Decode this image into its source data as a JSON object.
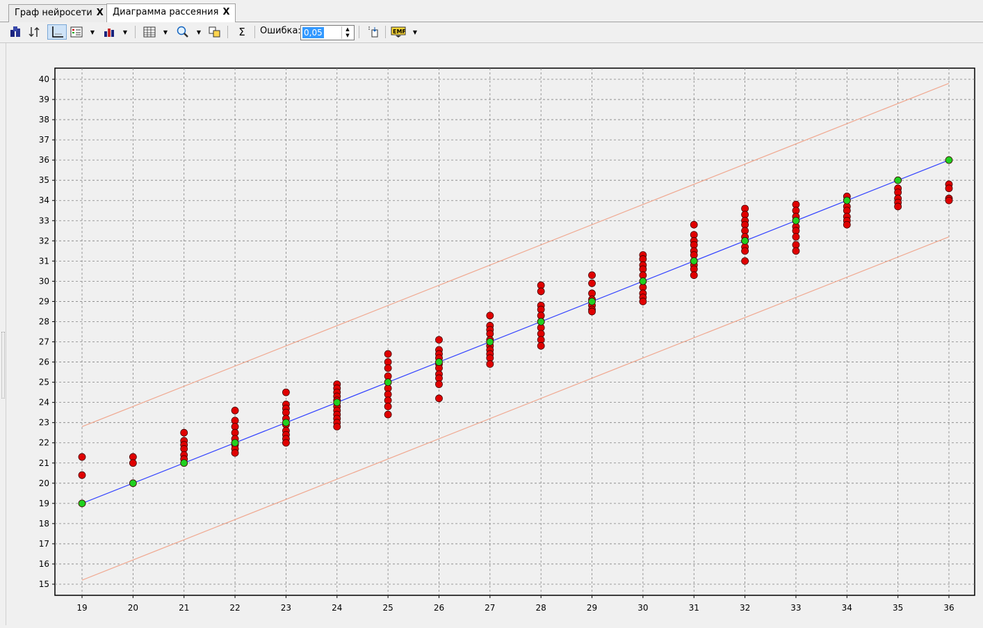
{
  "tabs": [
    {
      "label": "Граф нейросети",
      "close": "X"
    },
    {
      "label": "Диаграмма рассеяния",
      "close": "X"
    }
  ],
  "toolbar": {
    "error_label": "Ошибка:",
    "error_value": "0,05",
    "sigma": "Σ",
    "emf": "EMF"
  },
  "colors": {
    "plot_bg": "#f0f0f0",
    "ideal_line": "#3040ff",
    "tolerance_line": "#f0a890",
    "point_red": "#e00000",
    "point_green": "#20d020"
  },
  "chart_data": {
    "type": "scatter",
    "xlim": [
      19,
      36
    ],
    "ylim": [
      15,
      40
    ],
    "x_ticks": [
      19,
      20,
      21,
      22,
      23,
      24,
      25,
      26,
      27,
      28,
      29,
      30,
      31,
      32,
      33,
      34,
      35,
      36
    ],
    "y_ticks": [
      15,
      16,
      17,
      18,
      19,
      20,
      21,
      22,
      23,
      24,
      25,
      26,
      27,
      28,
      29,
      30,
      31,
      32,
      33,
      34,
      35,
      36,
      37,
      38,
      39,
      40
    ],
    "grid": true,
    "lines": [
      {
        "points": [
          [
            19,
            19
          ],
          [
            36,
            36
          ]
        ]
      },
      {
        "points": [
          [
            19,
            22.8
          ],
          [
            36,
            39.8
          ]
        ]
      },
      {
        "points": [
          [
            19,
            15.2
          ],
          [
            36,
            32.2
          ]
        ]
      }
    ],
    "series": [
      {
        "points": [
          [
            19,
            21.3
          ],
          [
            19,
            20.4
          ],
          [
            20,
            21.3
          ],
          [
            20,
            21.0
          ],
          [
            21,
            22.5
          ],
          [
            21,
            22.1
          ],
          [
            21,
            21.9
          ],
          [
            21,
            21.7
          ],
          [
            21,
            21.4
          ],
          [
            21,
            21.2
          ],
          [
            22,
            23.6
          ],
          [
            22,
            23.1
          ],
          [
            22,
            22.8
          ],
          [
            22,
            22.5
          ],
          [
            22,
            22.2
          ],
          [
            22,
            21.9
          ],
          [
            22,
            21.7
          ],
          [
            22,
            21.5
          ],
          [
            23,
            24.5
          ],
          [
            23,
            23.9
          ],
          [
            23,
            23.7
          ],
          [
            23,
            23.5
          ],
          [
            23,
            23.2
          ],
          [
            23,
            22.9
          ],
          [
            23,
            22.6
          ],
          [
            23,
            22.4
          ],
          [
            23,
            22.2
          ],
          [
            23,
            22.0
          ],
          [
            24,
            24.9
          ],
          [
            24,
            24.7
          ],
          [
            24,
            24.5
          ],
          [
            24,
            24.3
          ],
          [
            24,
            24.1
          ],
          [
            24,
            23.8
          ],
          [
            24,
            23.6
          ],
          [
            24,
            23.4
          ],
          [
            24,
            23.2
          ],
          [
            24,
            23.0
          ],
          [
            24,
            22.8
          ],
          [
            25,
            26.4
          ],
          [
            25,
            26.0
          ],
          [
            25,
            25.7
          ],
          [
            25,
            25.3
          ],
          [
            25,
            25.0
          ],
          [
            25,
            24.7
          ],
          [
            25,
            24.4
          ],
          [
            25,
            24.1
          ],
          [
            25,
            23.8
          ],
          [
            25,
            23.4
          ],
          [
            26,
            27.1
          ],
          [
            26,
            26.6
          ],
          [
            26,
            26.4
          ],
          [
            26,
            26.2
          ],
          [
            26,
            25.9
          ],
          [
            26,
            25.7
          ],
          [
            26,
            25.4
          ],
          [
            26,
            25.2
          ],
          [
            26,
            24.9
          ],
          [
            26,
            24.2
          ],
          [
            27,
            28.3
          ],
          [
            27,
            27.8
          ],
          [
            27,
            27.6
          ],
          [
            27,
            27.4
          ],
          [
            27,
            27.1
          ],
          [
            27,
            26.8
          ],
          [
            27,
            26.6
          ],
          [
            27,
            26.4
          ],
          [
            27,
            26.2
          ],
          [
            27,
            25.9
          ],
          [
            28,
            29.8
          ],
          [
            28,
            29.5
          ],
          [
            28,
            28.8
          ],
          [
            28,
            28.6
          ],
          [
            28,
            28.3
          ],
          [
            28,
            28.0
          ],
          [
            28,
            27.7
          ],
          [
            28,
            27.4
          ],
          [
            28,
            27.1
          ],
          [
            28,
            26.8
          ],
          [
            29,
            30.3
          ],
          [
            29,
            29.9
          ],
          [
            29,
            29.4
          ],
          [
            29,
            29.1
          ],
          [
            29,
            28.8
          ],
          [
            29,
            28.6
          ],
          [
            29,
            28.5
          ],
          [
            30,
            31.3
          ],
          [
            30,
            31.1
          ],
          [
            30,
            30.8
          ],
          [
            30,
            30.6
          ],
          [
            30,
            30.3
          ],
          [
            30,
            30.0
          ],
          [
            30,
            29.7
          ],
          [
            30,
            29.4
          ],
          [
            30,
            29.2
          ],
          [
            30,
            29.0
          ],
          [
            31,
            32.8
          ],
          [
            31,
            32.3
          ],
          [
            31,
            32.0
          ],
          [
            31,
            31.8
          ],
          [
            31,
            31.5
          ],
          [
            31,
            31.3
          ],
          [
            31,
            31.0
          ],
          [
            31,
            30.8
          ],
          [
            31,
            30.6
          ],
          [
            31,
            30.3
          ],
          [
            32,
            33.6
          ],
          [
            32,
            33.3
          ],
          [
            32,
            33.0
          ],
          [
            32,
            32.8
          ],
          [
            32,
            32.5
          ],
          [
            32,
            32.2
          ],
          [
            32,
            32.0
          ],
          [
            32,
            31.7
          ],
          [
            32,
            31.5
          ],
          [
            32,
            31.0
          ],
          [
            33,
            33.8
          ],
          [
            33,
            33.5
          ],
          [
            33,
            33.2
          ],
          [
            33,
            33.0
          ],
          [
            33,
            32.7
          ],
          [
            33,
            32.5
          ],
          [
            33,
            32.2
          ],
          [
            33,
            31.8
          ],
          [
            33,
            31.5
          ],
          [
            34,
            34.2
          ],
          [
            34,
            34.0
          ],
          [
            34,
            33.7
          ],
          [
            34,
            33.5
          ],
          [
            34,
            33.2
          ],
          [
            34,
            33.0
          ],
          [
            34,
            32.8
          ],
          [
            35,
            34.6
          ],
          [
            35,
            34.4
          ],
          [
            35,
            34.1
          ],
          [
            35,
            33.9
          ],
          [
            35,
            33.7
          ],
          [
            36,
            34.8
          ],
          [
            36,
            34.6
          ],
          [
            36,
            34.1
          ],
          [
            36,
            34.0
          ]
        ]
      },
      {
        "points": [
          [
            19,
            19
          ],
          [
            20,
            20
          ],
          [
            21,
            21
          ],
          [
            22,
            22
          ],
          [
            23,
            23
          ],
          [
            24,
            24
          ],
          [
            25,
            25
          ],
          [
            26,
            26
          ],
          [
            27,
            27
          ],
          [
            28,
            28
          ],
          [
            29,
            29
          ],
          [
            30,
            30
          ],
          [
            31,
            31
          ],
          [
            32,
            32
          ],
          [
            33,
            33
          ],
          [
            34,
            34
          ],
          [
            35,
            35
          ],
          [
            36,
            36
          ]
        ]
      }
    ]
  }
}
